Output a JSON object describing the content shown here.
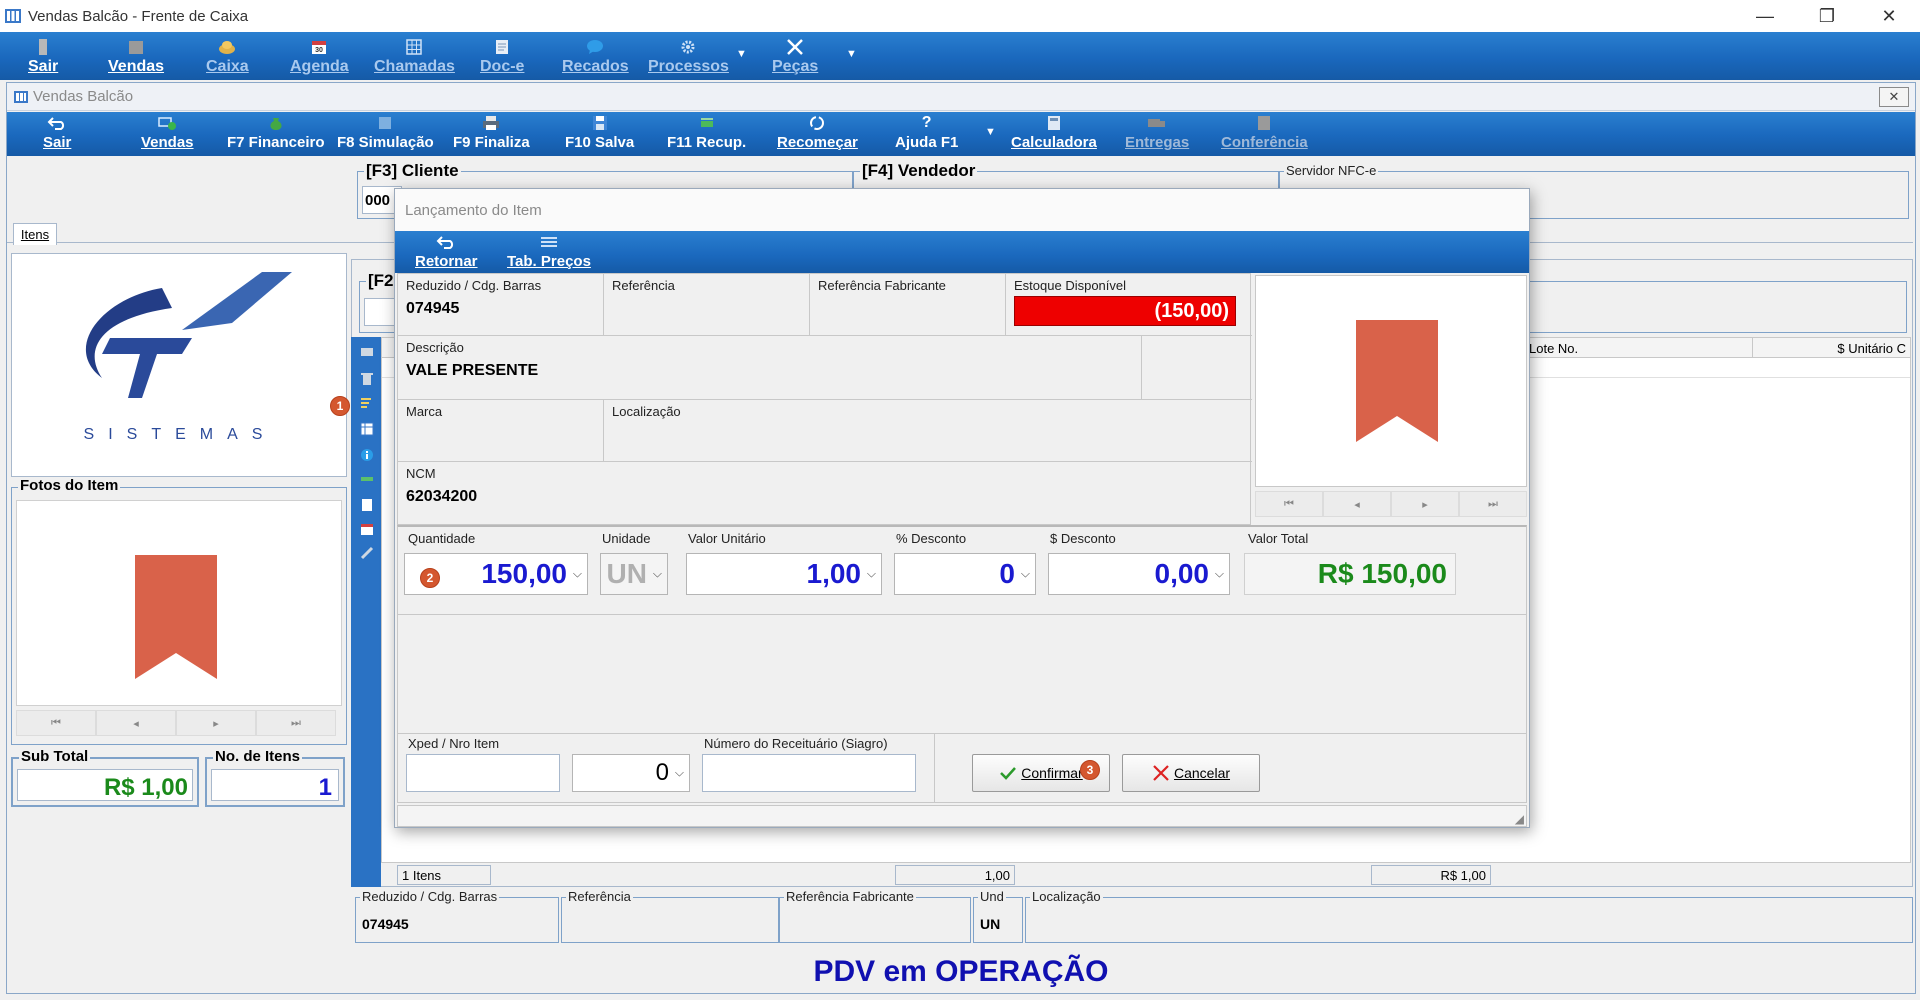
{
  "window": {
    "title": "Vendas Balcão - Frente de Caixa"
  },
  "ribbon": {
    "items": [
      {
        "label": "Sair",
        "icon": "door-icon"
      },
      {
        "label": "Vendas",
        "icon": "cart-icon"
      },
      {
        "label": "Caixa",
        "icon": "cash-icon"
      },
      {
        "label": "Agenda",
        "icon": "calendar-icon"
      },
      {
        "label": "Chamadas",
        "icon": "grid-icon"
      },
      {
        "label": "Doc-e",
        "icon": "document-icon"
      },
      {
        "label": "Recados",
        "icon": "chat-icon"
      },
      {
        "label": "Processos",
        "icon": "gear-icon"
      },
      {
        "label": "Peças",
        "icon": "tools-icon"
      }
    ]
  },
  "child": {
    "title": "Vendas Balcão",
    "toolbar": [
      {
        "label": "Sair"
      },
      {
        "label": "Vendas"
      },
      {
        "label": "F7 Financeiro"
      },
      {
        "label": "F8 Simulação"
      },
      {
        "label": "F9 Finaliza"
      },
      {
        "label": "F10 Salva"
      },
      {
        "label": "F11 Recup."
      },
      {
        "label": "Recomeçar"
      },
      {
        "label": "Ajuda F1"
      },
      {
        "label": "Calculadora"
      },
      {
        "label": "Entregas"
      },
      {
        "label": "Conferência"
      }
    ],
    "cliente_label": "[F3] Cliente",
    "cliente_value": "000",
    "vendedor_label": "[F4] Vendedor",
    "nfce_label": "Servidor NFC-e",
    "tab_itens": "Itens",
    "f2_label": "[F2",
    "logo_text": "SISTEMAS",
    "fotos_label": "Fotos do Item",
    "subtotal_label": "Sub Total",
    "subtotal_value": "R$ 1,00",
    "nitens_label": "No. de Itens",
    "nitens_value": "1",
    "grid_col_lote": "Lote No.",
    "grid_col_unit": "$ Unitário C",
    "status_itens": "1 Itens",
    "status_qty": "1,00",
    "status_total": "R$ 1,00",
    "bottom": {
      "reduzido_label": "Reduzido / Cdg. Barras",
      "reduzido_value": "074945",
      "referencia_label": "Referência",
      "ref_fab_label": "Referência Fabricante",
      "und_label": "Und",
      "und_value": "UN",
      "localizacao_label": "Localização"
    },
    "status_banner": "PDV em OPERAÇÃO"
  },
  "dialog": {
    "title": "Lançamento do Item",
    "toolbar": [
      {
        "label": "Retornar"
      },
      {
        "label": "Tab. Preços"
      }
    ],
    "reduzido_label": "Reduzido / Cdg. Barras",
    "reduzido_value": "074945",
    "referencia_label": "Referência",
    "ref_fab_label": "Referência Fabricante",
    "estoque_label": "Estoque Disponível",
    "estoque_value": "(150,00)",
    "descricao_label": "Descrição",
    "descricao_value": "VALE PRESENTE",
    "marca_label": "Marca",
    "localizacao_label": "Localização",
    "ncm_label": "NCM",
    "ncm_value": "62034200",
    "quantidade_label": "Quantidade",
    "quantidade_value": "150,00",
    "unidade_label": "Unidade",
    "unidade_value": "UN",
    "valor_unit_label": "Valor Unitário",
    "valor_unit_value": "1,00",
    "pct_desc_label": "% Desconto",
    "pct_desc_value": "0",
    "desc_label": "$ Desconto",
    "desc_value": "0,00",
    "valor_total_label": "Valor Total",
    "valor_total_value": "R$ 150,00",
    "xped_label": "Xped / Nro Item",
    "xped_item_value": "0",
    "receituario_label": "Número do Receituário (Siagro)",
    "confirmar_label": "Confirmar",
    "cancelar_label": "Cancelar"
  },
  "badges": {
    "b1": "1",
    "b2": "2",
    "b3": "3"
  },
  "colors": {
    "ribbon": "#1a68bd",
    "stock_negative_bg": "#ee0000",
    "value_blue": "#1a1ad0",
    "value_green": "#1b8a1b",
    "banner_blue": "#1010b0",
    "badge": "#d4572f",
    "bookmark": "#d9624a"
  }
}
